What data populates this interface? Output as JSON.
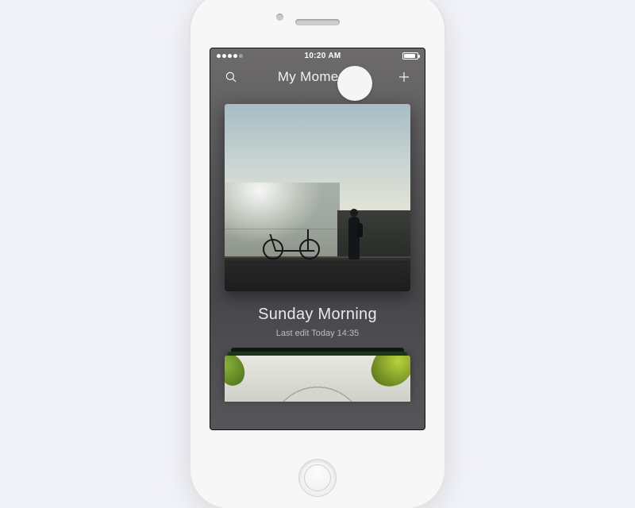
{
  "status": {
    "time": "10:20 AM"
  },
  "nav": {
    "title": "My Moments"
  },
  "card": {
    "title": "Sunday Morning",
    "subtitle": "Last edit Today 14:35"
  }
}
